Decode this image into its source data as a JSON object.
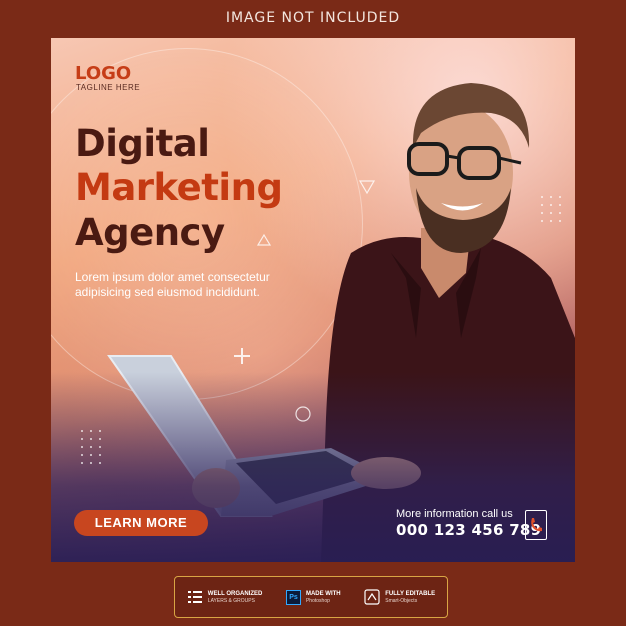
{
  "header": {
    "notice": "IMAGE NOT INCLUDED"
  },
  "post": {
    "logo": "LOGO",
    "tagline": "TAGLINE HERE",
    "headline": [
      "Digital",
      "Marketing",
      "Agency"
    ],
    "body": "Lorem ipsum dolor amet consectetur adipisicing sed eiusmod incididunt.",
    "cta_label": "LEARN MORE",
    "contact_label": "More information call us",
    "phone": "000 123 456 789"
  },
  "badges": [
    {
      "title": "WELL ORGANIZED",
      "subtitle": "LAYERS & GROUPS",
      "icon": "layers-icon"
    },
    {
      "title": "MADE WITH",
      "subtitle": "Photoshop",
      "icon": "photoshop-icon",
      "icon_text": "Ps"
    },
    {
      "title": "FULLY EDITABLE",
      "subtitle": "Smart-Objects",
      "icon": "smart-object-icon"
    }
  ],
  "colors": {
    "background": "#7a2a17",
    "accent": "#c8461f",
    "headline_dark": "#4a1a12",
    "badge_border": "#d9a544"
  }
}
